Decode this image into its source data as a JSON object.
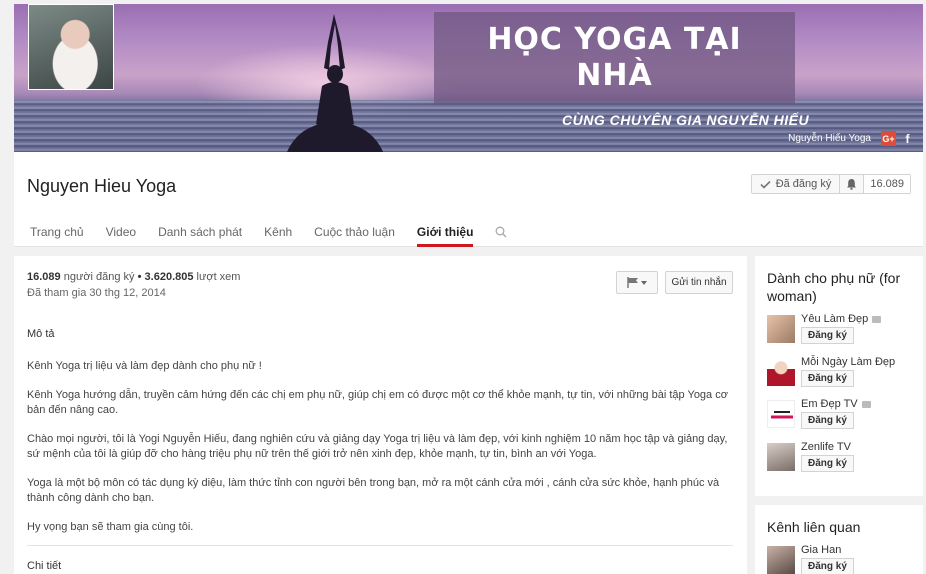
{
  "banner": {
    "title_line1": "HỌC YOGA TẠI",
    "title_line2": "NHÀ",
    "subtitle": "CÙNG CHUYÊN GIA NGUYỄN HIẾU",
    "link_text": "Nguyễn Hiếu Yoga",
    "gplus_label": "G+",
    "fb_label": "f"
  },
  "channel": {
    "name": "Nguyen Hieu Yoga",
    "subscribed_label": "Đã đăng ký",
    "subscriber_count": "16.089"
  },
  "tabs": [
    {
      "label": "Trang chủ",
      "active": false
    },
    {
      "label": "Video",
      "active": false
    },
    {
      "label": "Danh sách phát",
      "active": false
    },
    {
      "label": "Kênh",
      "active": false
    },
    {
      "label": "Cuộc thảo luận",
      "active": false
    },
    {
      "label": "Giới thiệu",
      "active": true
    }
  ],
  "about": {
    "subscribers": "16.089",
    "subscribers_suffix": "người đăng ký",
    "separator": "•",
    "views": "3.620.805",
    "views_suffix": "lượt xem",
    "joined": "Đã tham gia 30 thg 12, 2014",
    "message_button": "Gửi tin nhắn",
    "description_heading": "Mô tả",
    "description": [
      "Kênh Yoga trị liệu và làm đẹp dành cho phụ nữ !",
      "Kênh Yoga hướng dẫn, truyền cảm hứng đến các chị em phụ nữ, giúp chị em có được một cơ thể khỏe mạnh, tự tin, với những bài tập Yoga cơ bản đến nâng cao.",
      "Chào mọi người, tôi là Yogi Nguyễn Hiếu, đang nghiên cứu và giảng dạy Yoga trị liệu và làm đẹp, với kinh nghiệm 10 năm học tập và giảng dạy, sứ mệnh của tôi là giúp đỡ cho hàng triệu phụ nữ trên thế giới trở nên xinh đẹp, khỏe mạnh, tự tin, bình an với Yoga.",
      "Yoga là một bộ môn có tác dụng kỳ diệu, làm thức tỉnh con người bên trong bạn, mở ra một cánh cửa mới , cánh cửa sức khỏe, hạnh phúc và thành công dành cho bạn.",
      "Hy vọng bạn sẽ tham gia cùng tôi."
    ],
    "details_heading": "Chi tiết"
  },
  "sidebar": {
    "women_title": "Dành cho phụ nữ (for woman)",
    "women_channels": [
      {
        "name": "Yêu Làm Đẹp",
        "verified": true,
        "subscribe": "Đăng ký",
        "thumb_color": "#c9a48a"
      },
      {
        "name": "Mỗi Ngày Làm Đẹp",
        "verified": false,
        "subscribe": "Đăng ký",
        "thumb_color": "#b0162a"
      },
      {
        "name": "Em Đẹp TV",
        "verified": true,
        "subscribe": "Đăng ký",
        "thumb_color": "#d4145a"
      },
      {
        "name": "Zenlife TV",
        "verified": false,
        "subscribe": "Đăng ký",
        "thumb_color": "#8a7f7a"
      }
    ],
    "related_title": "Kênh liên quan",
    "related_channels": [
      {
        "name": "Gia Han",
        "subscribe": "Đăng ký",
        "thumb_color": "#6d5b55"
      }
    ]
  },
  "icons": {
    "check": "check-icon",
    "bell": "bell-icon",
    "search": "search-icon",
    "flag": "flag-icon"
  },
  "colors": {
    "accent_red": "#cc181e",
    "gplus": "#dd4b39"
  }
}
